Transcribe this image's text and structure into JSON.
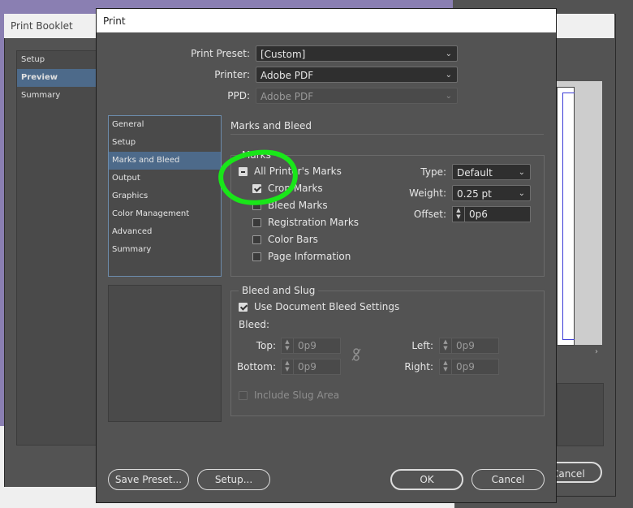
{
  "background_window": {
    "title": "Print Booklet",
    "nav_items": [
      {
        "label": "Setup",
        "selected": false
      },
      {
        "label": "Preview",
        "selected": true
      },
      {
        "label": "Summary",
        "selected": false
      }
    ],
    "cancel_label": "Cancel"
  },
  "dialog": {
    "title": "Print",
    "print_preset_label": "Print Preset:",
    "print_preset_value": "[Custom]",
    "printer_label": "Printer:",
    "printer_value": "Adobe PDF",
    "ppd_label": "PPD:",
    "ppd_value": "Adobe PDF",
    "categories": [
      {
        "label": "General",
        "selected": false
      },
      {
        "label": "Setup",
        "selected": false
      },
      {
        "label": "Marks and Bleed",
        "selected": true
      },
      {
        "label": "Output",
        "selected": false
      },
      {
        "label": "Graphics",
        "selected": false
      },
      {
        "label": "Color Management",
        "selected": false
      },
      {
        "label": "Advanced",
        "selected": false
      },
      {
        "label": "Summary",
        "selected": false
      }
    ],
    "section_title": "Marks and Bleed",
    "marks": {
      "group_title": "Marks",
      "all_printers_marks": {
        "label": "All Printer's Marks",
        "state": "mixed"
      },
      "crop_marks": {
        "label": "Crop Marks",
        "checked": true
      },
      "bleed_marks": {
        "label": "Bleed Marks",
        "checked": false
      },
      "registration_marks": {
        "label": "Registration Marks",
        "checked": false
      },
      "color_bars": {
        "label": "Color Bars",
        "checked": false
      },
      "page_information": {
        "label": "Page Information",
        "checked": false
      },
      "type_label": "Type:",
      "type_value": "Default",
      "weight_label": "Weight:",
      "weight_value": "0.25 pt",
      "offset_label": "Offset:",
      "offset_value": "0p6"
    },
    "bleed_slug": {
      "group_title": "Bleed and Slug",
      "use_document_bleed": {
        "label": "Use Document Bleed Settings",
        "checked": true
      },
      "bleed_label": "Bleed:",
      "top_label": "Top:",
      "top_value": "0p9",
      "bottom_label": "Bottom:",
      "bottom_value": "0p9",
      "left_label": "Left:",
      "left_value": "0p9",
      "right_label": "Right:",
      "right_value": "0p9",
      "include_slug": {
        "label": "Include Slug Area",
        "checked": false,
        "disabled": true
      },
      "link_icon": "chain-link-broken-icon"
    },
    "buttons": {
      "save_preset": "Save Preset...",
      "setup": "Setup...",
      "ok": "OK",
      "cancel": "Cancel"
    }
  },
  "annotation": {
    "color": "#19e619",
    "shape": "hand-drawn circle around Marks checkboxes"
  }
}
